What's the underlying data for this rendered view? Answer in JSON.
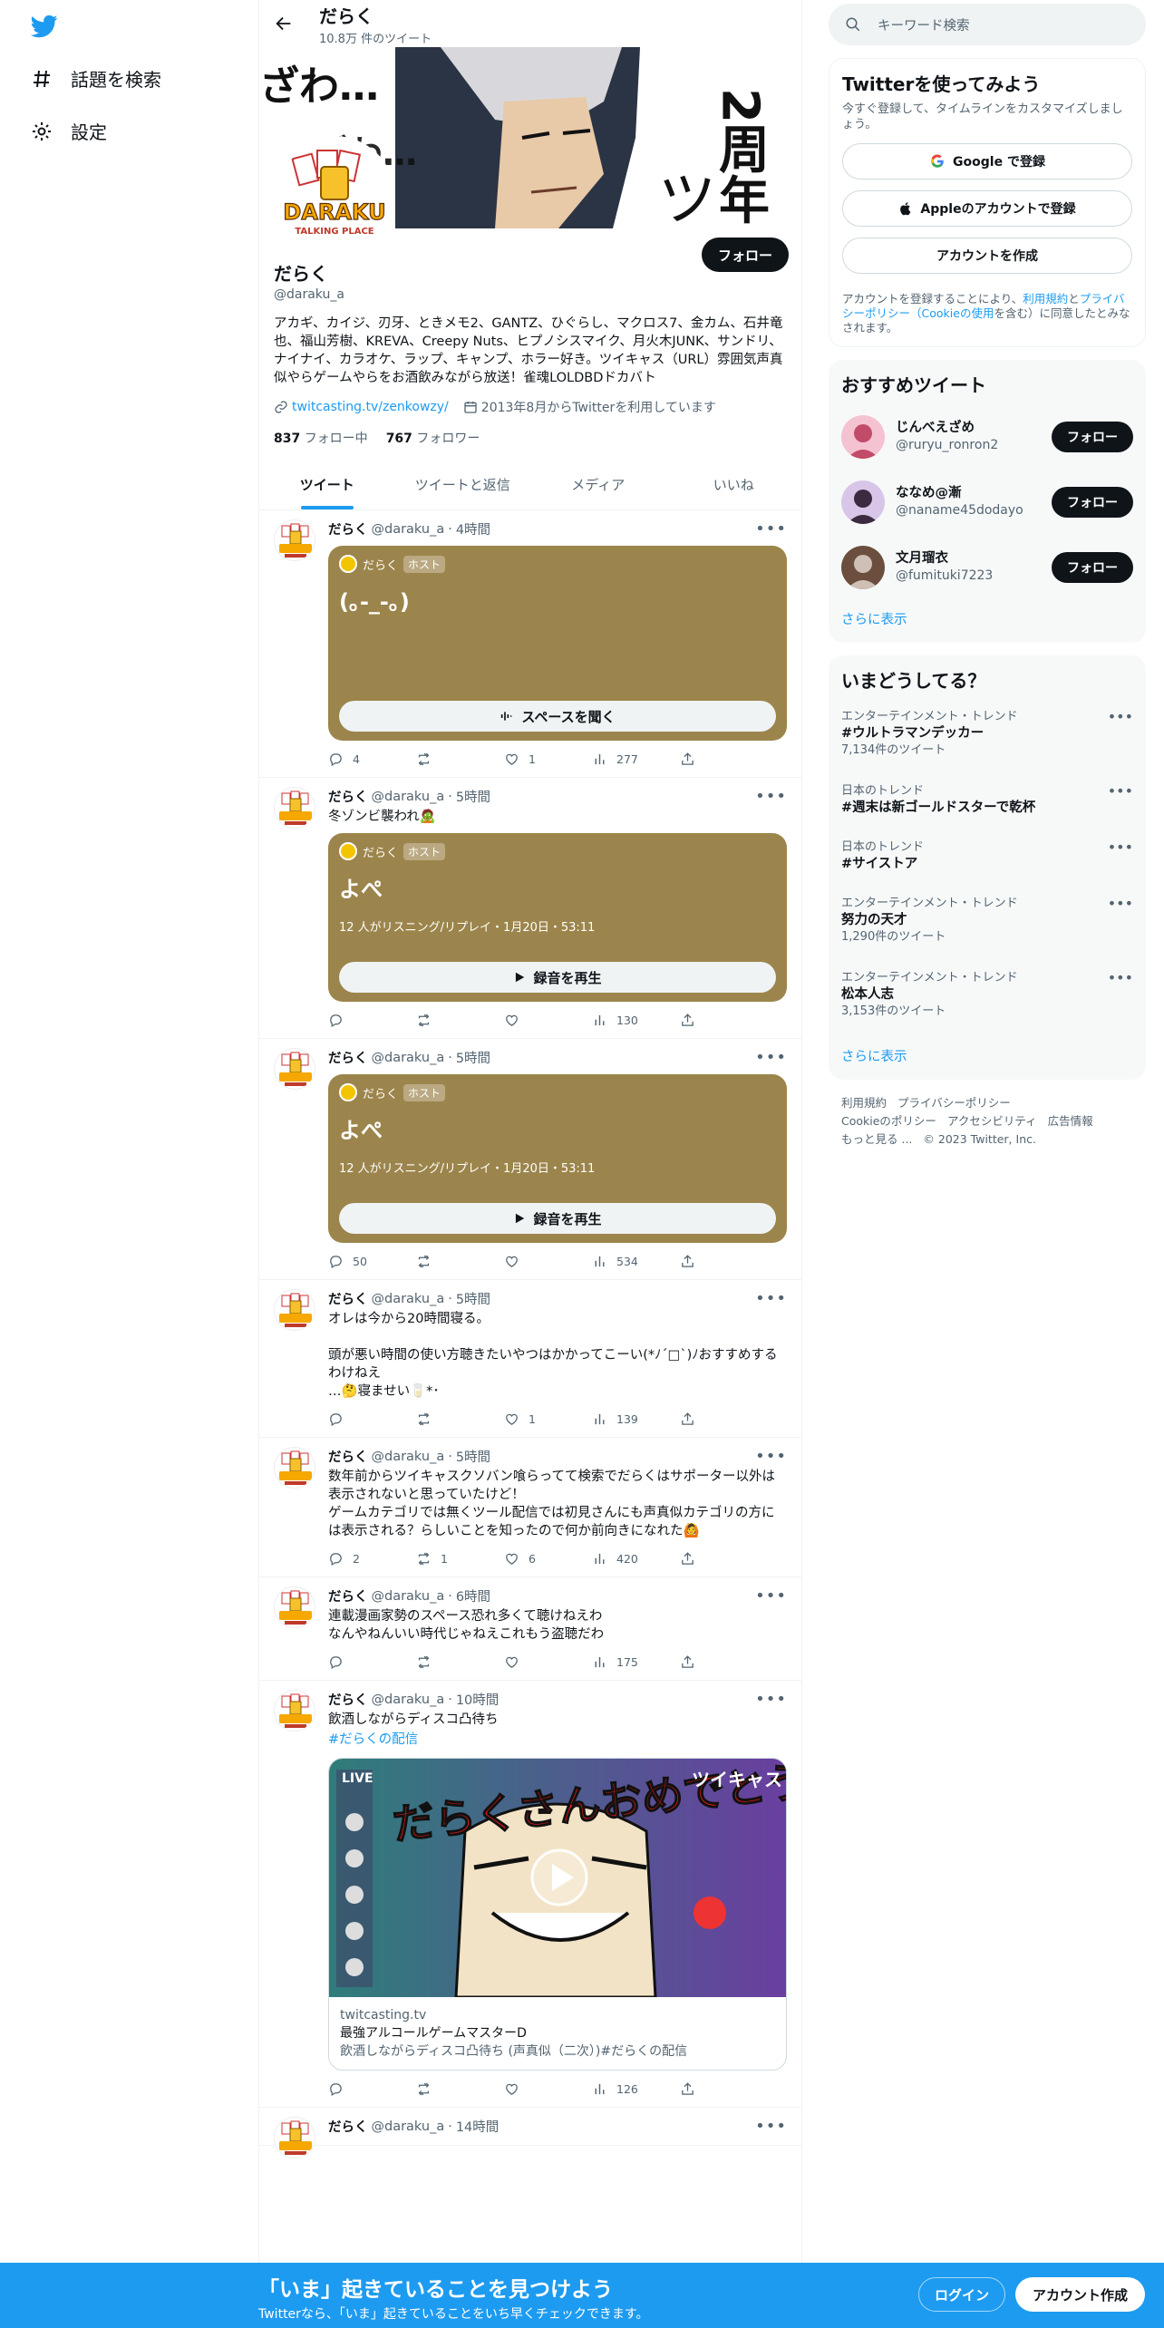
{
  "nav": {
    "explore": "話題を検索",
    "settings": "設定"
  },
  "header": {
    "name": "だらく",
    "tweet_count": "10.8万 件のツイート"
  },
  "banner": {
    "text1": "ざわ…",
    "text2": "ざわ…",
    "text3": "2周年",
    "text4": "ツ",
    "logo_text1": "DARAKU",
    "logo_text2": "TALKING PLACE"
  },
  "profile": {
    "follow_label": "フォロー",
    "name": "だらく",
    "handle": "@daraku_a",
    "bio": "アカギ、カイジ、刃牙、ときメモ2、GANTZ、ひぐらし、マクロス7、金カム、石井竜也、福山芳樹、KREVA、Creepy Nuts、ヒプノシスマイク、月火木JUNK、サンドリ、ナイナイ、カラオケ、ラップ、キャンプ、ホラー好き。ツイキャス（URL）雰囲気声真似やらゲームやらをお酒飲みながら放送！雀魂LOLDBDドカバト",
    "link": "twitcasting.tv/zenkowzy/",
    "joined": "2013年8月からTwitterを利用しています",
    "following_count": "837",
    "following_label": "フォロー中",
    "followers_count": "767",
    "followers_label": "フォロワー"
  },
  "tabs": [
    "ツイート",
    "ツイートと返信",
    "メディア",
    "いいね"
  ],
  "tweets": [
    {
      "name": "だらく",
      "handle": "@daraku_a",
      "time": "4時間",
      "text": "",
      "space": {
        "host": "だらく",
        "badge": "ホスト",
        "title": "(｡-_-｡)",
        "info": "",
        "button": "スペースを聞く"
      },
      "replies": "4",
      "retweets": "",
      "likes": "1",
      "views": "277"
    },
    {
      "name": "だらく",
      "handle": "@daraku_a",
      "time": "5時間",
      "text": "冬ゾンビ襲われ🧟",
      "space": {
        "host": "だらく",
        "badge": "ホスト",
        "title": "よぺ",
        "info": "12 人がリスニング/リプレイ・1月20日・53:11",
        "button": "録音を再生"
      },
      "replies": "",
      "retweets": "",
      "likes": "",
      "views": "130"
    },
    {
      "name": "だらく",
      "handle": "@daraku_a",
      "time": "5時間",
      "text": "",
      "space": {
        "host": "だらく",
        "badge": "ホスト",
        "title": "よぺ",
        "info": "12 人がリスニング/リプレイ・1月20日・53:11",
        "button": "録音を再生"
      },
      "replies": "50",
      "retweets": "",
      "likes": "",
      "views": "534"
    },
    {
      "name": "だらく",
      "handle": "@daraku_a",
      "time": "5時間",
      "text": "オレは今から20時間寝る。\n\n頭が悪い時間の使い方聴きたいやつはかかってこーい(*ﾉ´□`)ﾉおすすめするわけねえ\n…🤔寝ませい🥛*･",
      "replies": "",
      "retweets": "",
      "likes": "1",
      "views": "139"
    },
    {
      "name": "だらく",
      "handle": "@daraku_a",
      "time": "5時間",
      "text": "数年前からツイキャスクソバン喰らってて検索でだらくはサポーター以外は表示されないと思っていたけど！\nゲームカテゴリでは無くツール配信では初見さんにも声真似カテゴリの方には表示される？らしいことを知ったので何か前向きになれた🙆",
      "replies": "2",
      "retweets": "1",
      "likes": "6",
      "views": "420"
    },
    {
      "name": "だらく",
      "handle": "@daraku_a",
      "time": "6時間",
      "text": "連載漫画家勢のスペース恐れ多くて聴けねえわ\nなんやねんいい時代じゃねえこれもう盗聴だわ",
      "replies": "",
      "retweets": "",
      "likes": "",
      "views": "175"
    },
    {
      "name": "だらく",
      "handle": "@daraku_a",
      "time": "10時間",
      "text": "飲酒しながらディスコ凸待ち",
      "hashtag": "#だらくの配信",
      "card": {
        "overlay_live": "LIVE",
        "overlay_brand": "ツイキャス",
        "overlay_title": "だらくさんおめでとう",
        "domain": "twitcasting.tv",
        "title": "最強アルコールゲームマスターD",
        "desc": "飲酒しながらディスコ凸待ち (声真似（二次）)#だらくの配信"
      },
      "replies": "",
      "retweets": "",
      "likes": "",
      "views": "126"
    },
    {
      "name": "だらく",
      "handle": "@daraku_a",
      "time": "14時間"
    }
  ],
  "search": {
    "placeholder": "キーワード検索"
  },
  "signup_box": {
    "title": "Twitterを使ってみよう",
    "subtitle": "今すぐ登録して、タイムラインをカスタマイズしましょう。",
    "google": "Google で登録",
    "apple": "Appleのアカウントで登録",
    "create": "アカウントを作成",
    "legal_pre": "アカウントを登録することにより、",
    "legal_terms": "利用規約",
    "legal_and": "と",
    "legal_privacy": "プライバシーポリシー",
    "legal_cookie": "（Cookieの使用",
    "legal_post": "を含む）に同意したとみなされます。"
  },
  "recommended": {
    "title": "おすすめツイート",
    "show_more": "さらに表示",
    "users": [
      {
        "name": "じんべえざめ",
        "handle": "@ruryu_ronron2",
        "follow": "フォロー"
      },
      {
        "name": "ななめ@漸",
        "handle": "@naname45dodayo",
        "follow": "フォロー"
      },
      {
        "name": "文月瑠衣",
        "handle": "@fumituki7223",
        "follow": "フォロー"
      }
    ]
  },
  "trends": {
    "title": "いまどうしてる？",
    "show_more": "さらに表示",
    "items": [
      {
        "category": "エンターテインメント・トレンド",
        "name": "#ウルトラマンデッカー",
        "count": "7,134件のツイート"
      },
      {
        "category": "日本のトレンド",
        "name": "#週末は新ゴールドスターで乾杯",
        "count": ""
      },
      {
        "category": "日本のトレンド",
        "name": "#サイストア",
        "count": ""
      },
      {
        "category": "エンターテインメント・トレンド",
        "name": "努力の天才",
        "count": "1,290件のツイート"
      },
      {
        "category": "エンターテインメント・トレンド",
        "name": "松本人志",
        "count": "3,153件のツイート"
      }
    ]
  },
  "footer": {
    "terms": "利用規約",
    "privacy": "プライバシーポリシー",
    "cookie": "Cookieのポリシー",
    "access": "アクセシビリティ",
    "ads": "広告情報",
    "more": "もっと見る ...",
    "copyright": "© 2023 Twitter, Inc."
  },
  "bottom": {
    "title": "「いま」起きていることを見つけよう",
    "subtitle": "Twitterなら、「いま」起きていることをいち早くチェックできます。",
    "login": "ログイン",
    "signup": "アカウント作成"
  },
  "colors": {
    "accent": "#1d9bf0",
    "space_bg": "#9c854c",
    "dark": "#0f1419"
  }
}
